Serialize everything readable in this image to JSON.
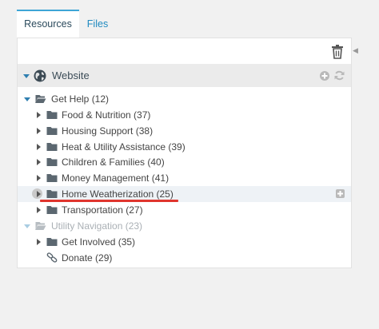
{
  "tabs": [
    {
      "label": "Resources",
      "active": true
    },
    {
      "label": "Files",
      "active": false
    }
  ],
  "toolbar": {
    "trash_icon": "trash-icon"
  },
  "tree_header": {
    "label": "Website",
    "icon": "globe-icon"
  },
  "tree": [
    {
      "label": "Get Help (12)",
      "depth": 0,
      "type": "folder-open",
      "expanded": true,
      "muted": false
    },
    {
      "label": "Food & Nutrition (37)",
      "depth": 1,
      "type": "folder",
      "expanded": false,
      "muted": false
    },
    {
      "label": "Housing Support (38)",
      "depth": 1,
      "type": "folder",
      "expanded": false,
      "muted": false
    },
    {
      "label": "Heat & Utility Assistance (39)",
      "depth": 1,
      "type": "folder",
      "expanded": false,
      "muted": false
    },
    {
      "label": "Children & Families (40)",
      "depth": 1,
      "type": "folder",
      "expanded": false,
      "muted": false
    },
    {
      "label": "Money Management (41)",
      "depth": 1,
      "type": "folder",
      "expanded": false,
      "muted": false
    },
    {
      "label": "Home Weatherization (25)",
      "depth": 1,
      "type": "folder",
      "expanded": false,
      "muted": false,
      "selected": true
    },
    {
      "label": "Transportation (27)",
      "depth": 1,
      "type": "folder",
      "expanded": false,
      "muted": false
    },
    {
      "label": "Utility Navigation (23)",
      "depth": 0,
      "type": "folder-open",
      "expanded": true,
      "muted": true
    },
    {
      "label": "Get Involved (35)",
      "depth": 1,
      "type": "folder",
      "expanded": false,
      "muted": false
    },
    {
      "label": "Donate (29)",
      "depth": 1,
      "type": "link",
      "expanded": false,
      "muted": false
    }
  ],
  "colors": {
    "accent": "#3ea5d6",
    "highlight_underline": "#e0352e",
    "folder": "#5b6770"
  }
}
